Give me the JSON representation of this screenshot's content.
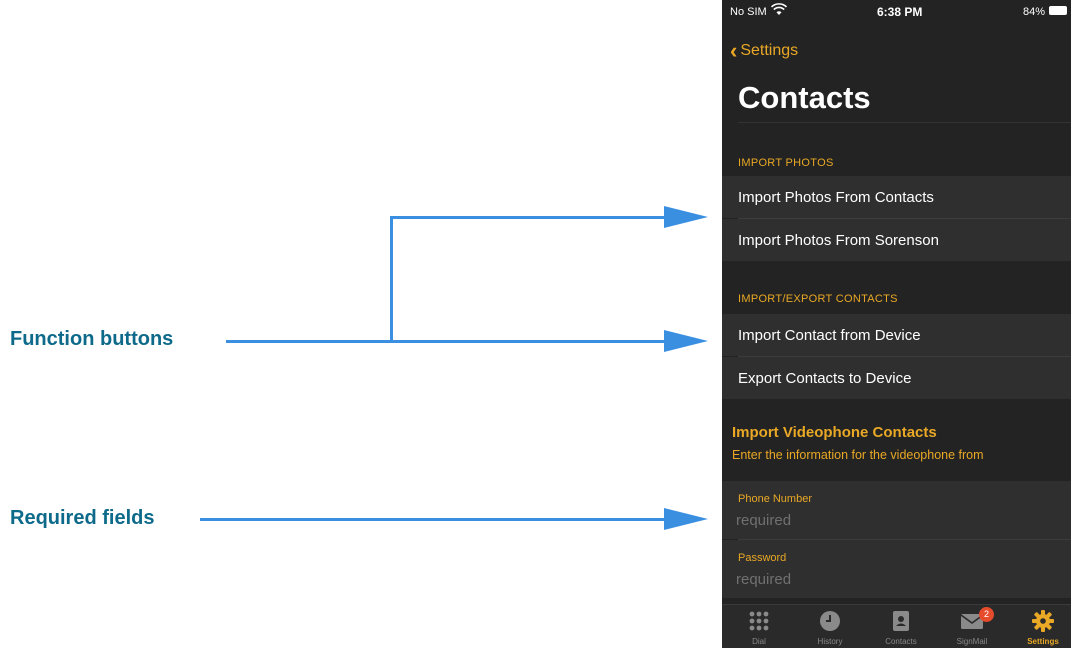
{
  "annotations": {
    "function_buttons": "Function buttons",
    "required_fields": "Required fields"
  },
  "status_bar": {
    "carrier": "No SIM",
    "time": "6:38 PM",
    "battery": "84%"
  },
  "nav": {
    "back_label": "Settings",
    "title": "Contacts"
  },
  "sections": {
    "import_photos": {
      "header": "IMPORT PHOTOS",
      "items": [
        "Import Photos From Contacts",
        "Import Photos From Sorenson"
      ]
    },
    "import_export": {
      "header": "IMPORT/EXPORT CONTACTS",
      "items": [
        "Import Contact from Device",
        "Export Contacts to Device"
      ]
    }
  },
  "videophone": {
    "title": "Import Videophone Contacts",
    "subtitle": "Enter the information for the videophone from",
    "fields": [
      {
        "label": "Phone Number",
        "placeholder": "required",
        "value": ""
      },
      {
        "label": "Password",
        "placeholder": "required",
        "value": ""
      }
    ]
  },
  "tabbar": {
    "items": [
      {
        "label": "Dial",
        "icon": "keypad-icon"
      },
      {
        "label": "History",
        "icon": "clock-icon"
      },
      {
        "label": "Contacts",
        "icon": "address-book-icon"
      },
      {
        "label": "SignMail",
        "icon": "envelope-icon",
        "badge": "2"
      },
      {
        "label": "Settings",
        "icon": "gear-icon",
        "active": true
      }
    ]
  },
  "colors": {
    "accent": "#e9a825",
    "annotation_text": "#0e6a8a",
    "annotation_line": "#3a8fe0",
    "background": "#232323",
    "row": "#2f2f2f",
    "badge": "#e64b2c"
  }
}
